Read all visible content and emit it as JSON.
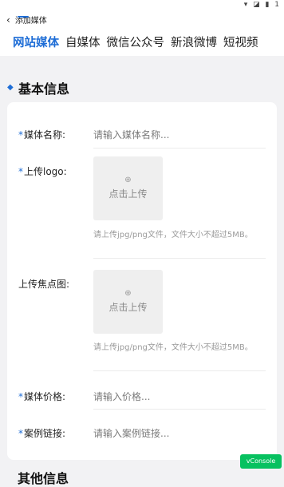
{
  "header": {
    "status_icons": "▾ ◪ ▮ 1",
    "back_label": "添加媒体"
  },
  "tabs": [
    {
      "label": "网站媒体",
      "active": true
    },
    {
      "label": "自媒体",
      "active": false
    },
    {
      "label": "微信公众号",
      "active": false
    },
    {
      "label": "新浪微博",
      "active": false
    },
    {
      "label": "短视频",
      "active": false
    }
  ],
  "section": {
    "title": "基本信息"
  },
  "form": {
    "name": {
      "required_mark": "*",
      "label": "媒体名称:",
      "placeholder": "请输入媒体名称..."
    },
    "logo": {
      "required_mark": "*",
      "label": "上传logo:",
      "upload_icon": "⊕",
      "upload_text": "点击上传",
      "hint": "请上传jpg/png文件，文件大小不超过5MB。"
    },
    "focus_image": {
      "label": "上传焦点图:",
      "upload_icon": "⊕",
      "upload_text": "点击上传",
      "hint": "请上传jpg/png文件，文件大小不超过5MB。"
    },
    "price": {
      "required_mark": "*",
      "label": "媒体价格:",
      "placeholder": "请输入价格..."
    },
    "case_link": {
      "required_mark": "*",
      "label": "案例链接:",
      "placeholder": "请输入案例链接..."
    }
  },
  "next_section": {
    "title": "其他信息"
  },
  "vconsole": {
    "label": "vConsole"
  },
  "colors": {
    "accent": "#1e6dd6",
    "vconsole": "#07c160",
    "background": "#f2f2f4"
  }
}
